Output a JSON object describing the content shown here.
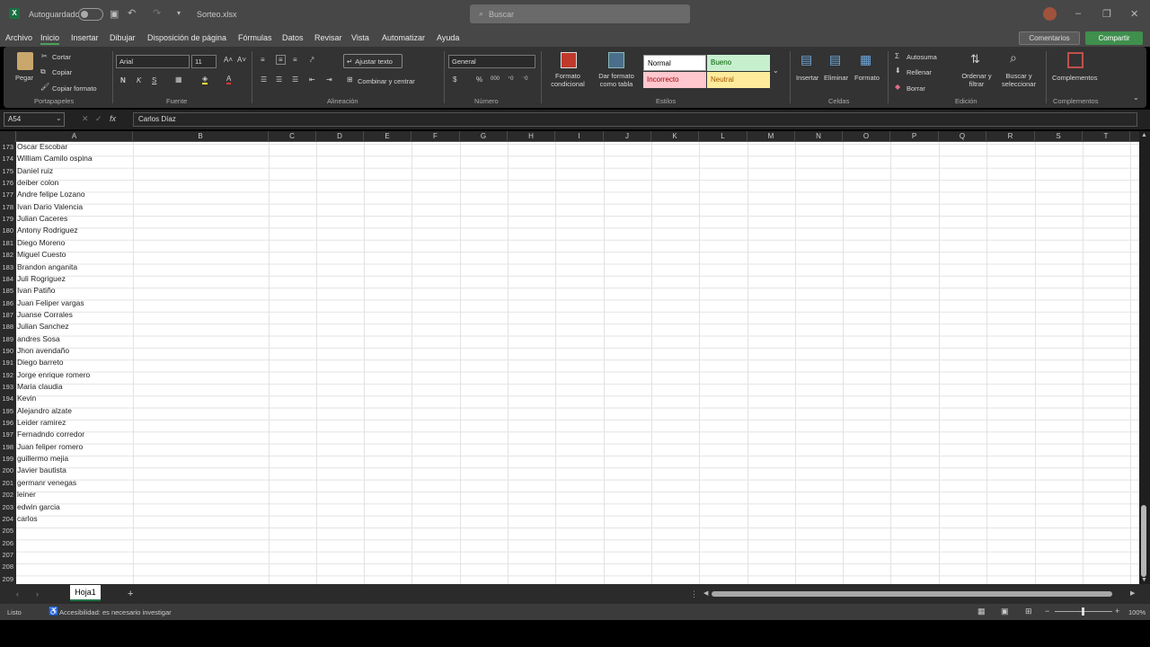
{
  "titlebar": {
    "autosave_label": "Autoguardado",
    "filename": "Sorteo.xlsx",
    "search_placeholder": "Buscar",
    "minimize": "–",
    "restore": "❐",
    "close": "✕"
  },
  "menu": {
    "items": [
      "Archivo",
      "Inicio",
      "Insertar",
      "Dibujar",
      "Disposición de página",
      "Fórmulas",
      "Datos",
      "Revisar",
      "Vista",
      "Automatizar",
      "Ayuda"
    ],
    "active": "Inicio",
    "comments_label": "Comentarios",
    "share_label": "Compartir"
  },
  "ribbon": {
    "clipboard": {
      "paste": "Pegar",
      "cut": "Cortar",
      "copy": "Copiar",
      "format_painter": "Copiar formato",
      "group": "Portapapeles"
    },
    "font": {
      "name": "Arial",
      "size": "11",
      "bold": "N",
      "italic": "K",
      "underline": "S",
      "group": "Fuente"
    },
    "alignment": {
      "wrap": "Ajustar texto",
      "merge": "Combinar y centrar",
      "group": "Alineación"
    },
    "number": {
      "format": "General",
      "group": "Número"
    },
    "styles": {
      "cond_format": "Formato condicional",
      "table_format": "Dar formato como tabla",
      "cells": [
        {
          "label": "Normal",
          "bg": "#ffffff",
          "fg": "#000000"
        },
        {
          "label": "Bueno",
          "bg": "#c6efce",
          "fg": "#006100"
        },
        {
          "label": "Incorrecto",
          "bg": "#ffc7ce",
          "fg": "#9c0006"
        },
        {
          "label": "Neutral",
          "bg": "#ffeb9c",
          "fg": "#9c5700"
        }
      ],
      "group": "Estilos"
    },
    "cells": {
      "insert": "Insertar",
      "delete": "Eliminar",
      "format": "Formato",
      "group": "Celdas"
    },
    "editing": {
      "autosum": "Autosuma",
      "fill": "Rellenar",
      "clear": "Borrar",
      "sort": "Ordenar y filtrar",
      "find": "Buscar y seleccionar",
      "group": "Edición"
    },
    "addins": {
      "label": "Complementos",
      "group": "Complementos"
    }
  },
  "formula_bar": {
    "name_box": "A54",
    "fx": "fx",
    "content": "Carlos Díaz"
  },
  "columns": [
    "A",
    "B",
    "C",
    "D",
    "E",
    "F",
    "G",
    "H",
    "I",
    "J",
    "K",
    "L",
    "M",
    "N",
    "O",
    "P",
    "Q",
    "R",
    "S",
    "T"
  ],
  "rows": [
    {
      "n": "173",
      "a": "Oscar Escobar"
    },
    {
      "n": "174",
      "a": "William Camilo ospina"
    },
    {
      "n": "175",
      "a": "Daniel ruiz"
    },
    {
      "n": "176",
      "a": "deiber colon"
    },
    {
      "n": "177",
      "a": "Andre felipe Lozano"
    },
    {
      "n": "178",
      "a": "Ivan Dario Valencia"
    },
    {
      "n": "179",
      "a": "Julian Caceres"
    },
    {
      "n": "180",
      "a": "Antony Rodriguez"
    },
    {
      "n": "181",
      "a": "Diego Moreno"
    },
    {
      "n": "182",
      "a": "Miguel Cuesto"
    },
    {
      "n": "183",
      "a": "Brandon anganita"
    },
    {
      "n": "184",
      "a": "Juli Rogriguez"
    },
    {
      "n": "185",
      "a": "Ivan Patiño"
    },
    {
      "n": "186",
      "a": "Juan Feliper vargas"
    },
    {
      "n": "187",
      "a": "Juanse Corrales"
    },
    {
      "n": "188",
      "a": "Julian Sanchez"
    },
    {
      "n": "189",
      "a": "andres Sosa"
    },
    {
      "n": "190",
      "a": "Jhon avendaño"
    },
    {
      "n": "191",
      "a": "Diego barreto"
    },
    {
      "n": "192",
      "a": "Jorge enrique romero"
    },
    {
      "n": "193",
      "a": "Maria claudia"
    },
    {
      "n": "194",
      "a": "Kevin"
    },
    {
      "n": "195",
      "a": "Alejandro alzate"
    },
    {
      "n": "196",
      "a": "Leider ramirez"
    },
    {
      "n": "197",
      "a": "Fernadndo corredor"
    },
    {
      "n": "198",
      "a": "Juan feliper romero"
    },
    {
      "n": "199",
      "a": "guillermo mejia"
    },
    {
      "n": "200",
      "a": "Javier bautista"
    },
    {
      "n": "201",
      "a": "germanr venegas"
    },
    {
      "n": "202",
      "a": "leiner"
    },
    {
      "n": "203",
      "a": "edwin garcia"
    },
    {
      "n": "204",
      "a": "carlos"
    },
    {
      "n": "205",
      "a": ""
    },
    {
      "n": "206",
      "a": ""
    },
    {
      "n": "207",
      "a": ""
    },
    {
      "n": "208",
      "a": ""
    },
    {
      "n": "209",
      "a": ""
    }
  ],
  "sheets": {
    "active": "Hoja1",
    "add": "+"
  },
  "status": {
    "ready": "Listo",
    "accessibility": "Accesibilidad: es necesario investigar",
    "zoom": "100%"
  }
}
